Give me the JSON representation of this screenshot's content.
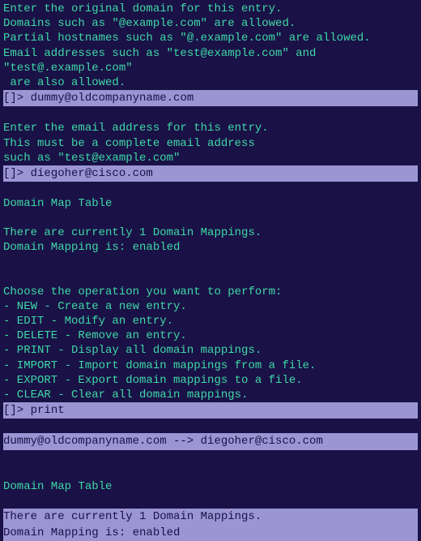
{
  "block1": {
    "l1": "Enter the original domain for this entry.",
    "l2": "Domains such as \"@example.com\" are allowed.",
    "l3": "Partial hostnames such as \"@.example.com\" are allowed.",
    "l4": "Email addresses such as \"test@example.com\" and \"test@.example.com\"",
    "l5": " are also allowed.",
    "prompt": "[]> ",
    "input": "dummy@oldcompanyname.com"
  },
  "block2": {
    "l1": "Enter the email address for this entry.",
    "l2": "This must be a complete email address",
    "l3": "such as \"test@example.com\"",
    "prompt": "[]> ",
    "input": "diegoher@cisco.com"
  },
  "block3": {
    "title": "Domain Map Table",
    "count": "There are currently 1 Domain Mappings.",
    "status": "Domain Mapping is: enabled"
  },
  "menu": {
    "header": "Choose the operation you want to perform:",
    "m1": "- NEW - Create a new entry.",
    "m2": "- EDIT - Modify an entry.",
    "m3": "- DELETE - Remove an entry.",
    "m4": "- PRINT - Display all domain mappings.",
    "m5": "- IMPORT - Import domain mappings from a file.",
    "m6": "- EXPORT - Export domain mappings to a file.",
    "m7": "- CLEAR - Clear all domain mappings.",
    "prompt": "[]> ",
    "input": "print"
  },
  "result": {
    "mapping": "dummy@oldcompanyname.com --> diegoher@cisco.com"
  },
  "block4": {
    "title": "Domain Map Table",
    "count": "There are currently 1 Domain Mappings.",
    "status": "Domain Mapping is: enabled"
  }
}
